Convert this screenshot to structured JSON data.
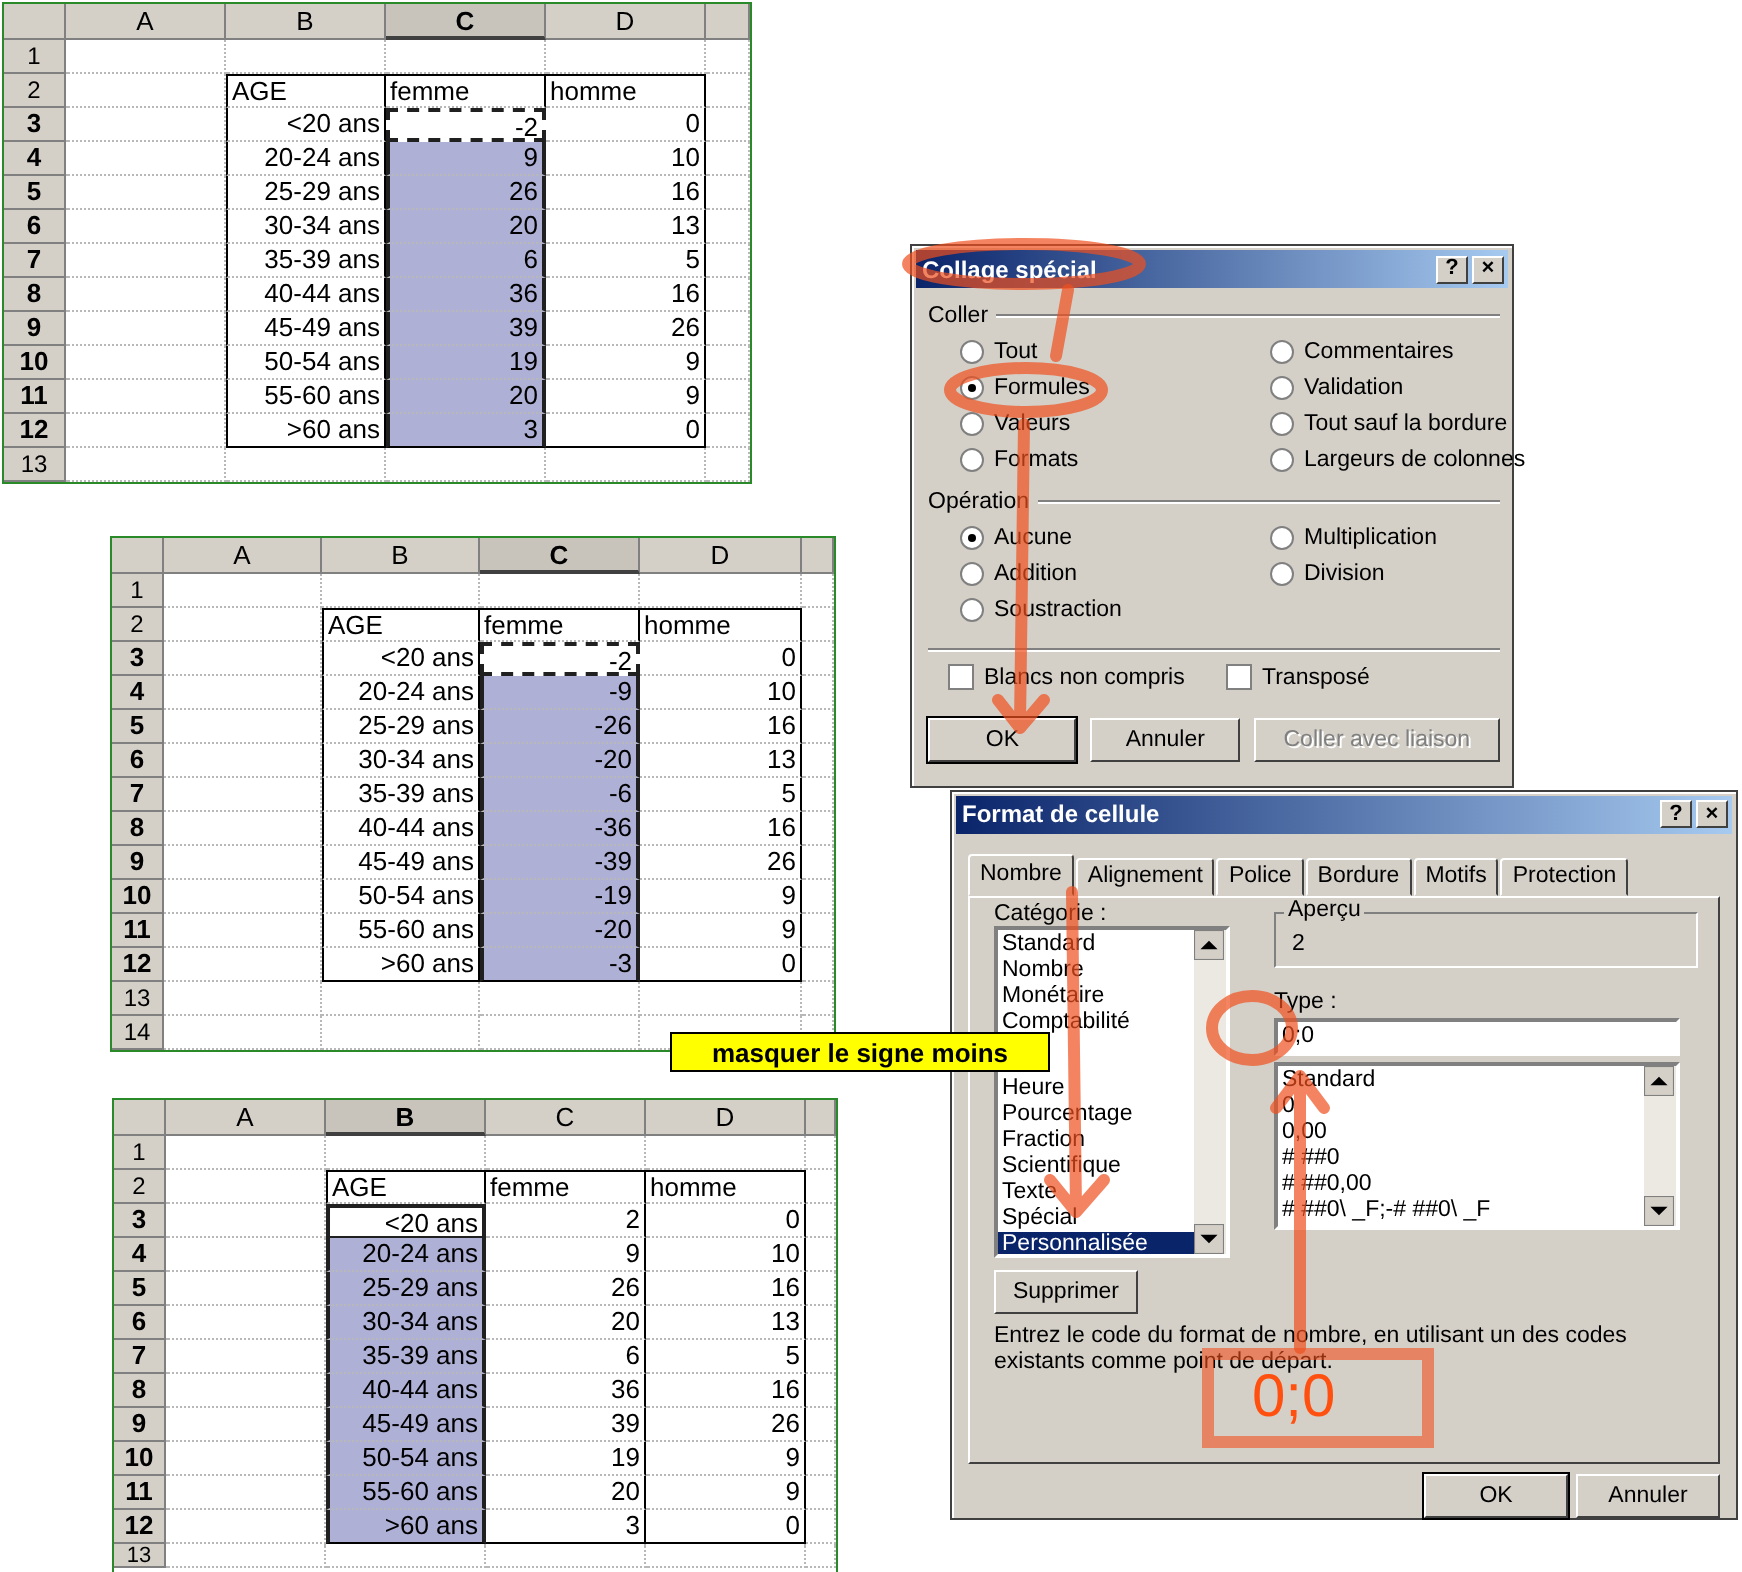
{
  "sheets": [
    {
      "columns": [
        {
          "label": "A",
          "selected": false
        },
        {
          "label": "B",
          "selected": false
        },
        {
          "label": "C",
          "selected": true
        },
        {
          "label": "D",
          "selected": false
        }
      ],
      "rows": [
        {
          "label": "1",
          "selected": false
        },
        {
          "label": "2",
          "selected": false,
          "cells": [
            {
              "text": "AGE",
              "selected": false
            },
            {
              "text": "femme",
              "selected": false
            },
            {
              "text": "homme",
              "selected": false
            }
          ]
        },
        {
          "label": "3",
          "selected": true,
          "cells": [
            {
              "text": "<20 ans",
              "selected": false
            },
            {
              "text": "-2",
              "selected": false,
              "marquee": true
            },
            {
              "text": "0",
              "selected": false
            }
          ]
        },
        {
          "label": "4",
          "selected": true,
          "cells": [
            {
              "text": "20-24 ans",
              "selected": false
            },
            {
              "text": "9",
              "selected": true
            },
            {
              "text": "10",
              "selected": false
            }
          ]
        },
        {
          "label": "5",
          "selected": true,
          "cells": [
            {
              "text": "25-29 ans",
              "selected": false
            },
            {
              "text": "26",
              "selected": true
            },
            {
              "text": "16",
              "selected": false
            }
          ]
        },
        {
          "label": "6",
          "selected": true,
          "cells": [
            {
              "text": "30-34 ans",
              "selected": false
            },
            {
              "text": "20",
              "selected": true
            },
            {
              "text": "13",
              "selected": false
            }
          ]
        },
        {
          "label": "7",
          "selected": true,
          "cells": [
            {
              "text": "35-39 ans",
              "selected": false
            },
            {
              "text": "6",
              "selected": true
            },
            {
              "text": "5",
              "selected": false
            }
          ]
        },
        {
          "label": "8",
          "selected": true,
          "cells": [
            {
              "text": "40-44 ans",
              "selected": false
            },
            {
              "text": "36",
              "selected": true
            },
            {
              "text": "16",
              "selected": false
            }
          ]
        },
        {
          "label": "9",
          "selected": true,
          "cells": [
            {
              "text": "45-49 ans",
              "selected": false
            },
            {
              "text": "39",
              "selected": true
            },
            {
              "text": "26",
              "selected": false
            }
          ]
        },
        {
          "label": "10",
          "selected": true,
          "cells": [
            {
              "text": "50-54 ans",
              "selected": false
            },
            {
              "text": "19",
              "selected": true
            },
            {
              "text": "9",
              "selected": false
            }
          ]
        },
        {
          "label": "11",
          "selected": true,
          "cells": [
            {
              "text": "55-60 ans",
              "selected": false
            },
            {
              "text": "20",
              "selected": true
            },
            {
              "text": "9",
              "selected": false
            }
          ]
        },
        {
          "label": "12",
          "selected": true,
          "cells": [
            {
              "text": ">60 ans",
              "selected": false
            },
            {
              "text": "3",
              "selected": true
            },
            {
              "text": "0",
              "selected": false
            }
          ]
        },
        {
          "label": "13",
          "selected": false
        }
      ]
    },
    {
      "columns": [
        {
          "label": "A",
          "selected": false
        },
        {
          "label": "B",
          "selected": false
        },
        {
          "label": "C",
          "selected": true
        },
        {
          "label": "D",
          "selected": false
        }
      ],
      "rows": [
        {
          "label": "1",
          "selected": false
        },
        {
          "label": "2",
          "selected": false,
          "cells": [
            {
              "text": "AGE",
              "selected": false
            },
            {
              "text": "femme",
              "selected": false
            },
            {
              "text": "homme",
              "selected": false
            }
          ]
        },
        {
          "label": "3",
          "selected": true,
          "cells": [
            {
              "text": "<20 ans",
              "selected": false
            },
            {
              "text": "-2",
              "selected": false,
              "marquee": true
            },
            {
              "text": "0",
              "selected": false
            }
          ]
        },
        {
          "label": "4",
          "selected": true,
          "cells": [
            {
              "text": "20-24 ans",
              "selected": false
            },
            {
              "text": "-9",
              "selected": true
            },
            {
              "text": "10",
              "selected": false
            }
          ]
        },
        {
          "label": "5",
          "selected": true,
          "cells": [
            {
              "text": "25-29 ans",
              "selected": false
            },
            {
              "text": "-26",
              "selected": true
            },
            {
              "text": "16",
              "selected": false
            }
          ]
        },
        {
          "label": "6",
          "selected": true,
          "cells": [
            {
              "text": "30-34 ans",
              "selected": false
            },
            {
              "text": "-20",
              "selected": true
            },
            {
              "text": "13",
              "selected": false
            }
          ]
        },
        {
          "label": "7",
          "selected": true,
          "cells": [
            {
              "text": "35-39 ans",
              "selected": false
            },
            {
              "text": "-6",
              "selected": true
            },
            {
              "text": "5",
              "selected": false
            }
          ]
        },
        {
          "label": "8",
          "selected": true,
          "cells": [
            {
              "text": "40-44 ans",
              "selected": false
            },
            {
              "text": "-36",
              "selected": true
            },
            {
              "text": "16",
              "selected": false
            }
          ]
        },
        {
          "label": "9",
          "selected": true,
          "cells": [
            {
              "text": "45-49 ans",
              "selected": false
            },
            {
              "text": "-39",
              "selected": true
            },
            {
              "text": "26",
              "selected": false
            }
          ]
        },
        {
          "label": "10",
          "selected": true,
          "cells": [
            {
              "text": "50-54 ans",
              "selected": false
            },
            {
              "text": "-19",
              "selected": true
            },
            {
              "text": "9",
              "selected": false
            }
          ]
        },
        {
          "label": "11",
          "selected": true,
          "cells": [
            {
              "text": "55-60 ans",
              "selected": false
            },
            {
              "text": "-20",
              "selected": true
            },
            {
              "text": "9",
              "selected": false
            }
          ]
        },
        {
          "label": "12",
          "selected": true,
          "cells": [
            {
              "text": ">60 ans",
              "selected": false
            },
            {
              "text": "-3",
              "selected": true
            },
            {
              "text": "0",
              "selected": false
            }
          ]
        },
        {
          "label": "13",
          "selected": false
        },
        {
          "label": "14",
          "selected": false
        }
      ]
    },
    {
      "columns": [
        {
          "label": "A",
          "selected": false
        },
        {
          "label": "B",
          "selected": true
        },
        {
          "label": "C",
          "selected": false
        },
        {
          "label": "D",
          "selected": false
        }
      ],
      "rows": [
        {
          "label": "1",
          "selected": false
        },
        {
          "label": "2",
          "selected": false,
          "cells": [
            {
              "text": "AGE",
              "selected": false
            },
            {
              "text": "femme",
              "selected": false
            },
            {
              "text": "homme",
              "selected": false
            }
          ]
        },
        {
          "label": "3",
          "selected": true,
          "cells": [
            {
              "text": "<20 ans",
              "selected": false,
              "active": true
            },
            {
              "text": "2",
              "selected": false
            },
            {
              "text": "0",
              "selected": false
            }
          ]
        },
        {
          "label": "4",
          "selected": true,
          "cells": [
            {
              "text": "20-24 ans",
              "selected": true
            },
            {
              "text": "9",
              "selected": false
            },
            {
              "text": "10",
              "selected": false
            }
          ]
        },
        {
          "label": "5",
          "selected": true,
          "cells": [
            {
              "text": "25-29 ans",
              "selected": true
            },
            {
              "text": "26",
              "selected": false
            },
            {
              "text": "16",
              "selected": false
            }
          ]
        },
        {
          "label": "6",
          "selected": true,
          "cells": [
            {
              "text": "30-34 ans",
              "selected": true
            },
            {
              "text": "20",
              "selected": false
            },
            {
              "text": "13",
              "selected": false
            }
          ]
        },
        {
          "label": "7",
          "selected": true,
          "cells": [
            {
              "text": "35-39 ans",
              "selected": true
            },
            {
              "text": "6",
              "selected": false
            },
            {
              "text": "5",
              "selected": false
            }
          ]
        },
        {
          "label": "8",
          "selected": true,
          "cells": [
            {
              "text": "40-44 ans",
              "selected": true
            },
            {
              "text": "36",
              "selected": false
            },
            {
              "text": "16",
              "selected": false
            }
          ]
        },
        {
          "label": "9",
          "selected": true,
          "cells": [
            {
              "text": "45-49 ans",
              "selected": true
            },
            {
              "text": "39",
              "selected": false
            },
            {
              "text": "26",
              "selected": false
            }
          ]
        },
        {
          "label": "10",
          "selected": true,
          "cells": [
            {
              "text": "50-54 ans",
              "selected": true
            },
            {
              "text": "19",
              "selected": false
            },
            {
              "text": "9",
              "selected": false
            }
          ]
        },
        {
          "label": "11",
          "selected": true,
          "cells": [
            {
              "text": "55-60 ans",
              "selected": true
            },
            {
              "text": "20",
              "selected": false
            },
            {
              "text": "9",
              "selected": false
            }
          ]
        },
        {
          "label": "12",
          "selected": true,
          "cells": [
            {
              "text": ">60 ans",
              "selected": true
            },
            {
              "text": "3",
              "selected": false
            },
            {
              "text": "0",
              "selected": false
            }
          ]
        },
        {
          "label": "13",
          "selected": false
        }
      ]
    }
  ],
  "paste_special": {
    "title": "Collage spécial",
    "title_buttons": [
      "?",
      "×"
    ],
    "groups": [
      {
        "label": "Coller",
        "options": [
          {
            "label": "Tout",
            "selected": false
          },
          {
            "label": "Formules",
            "selected": true
          },
          {
            "label": "Valeurs",
            "selected": false
          },
          {
            "label": "Formats",
            "selected": false
          },
          {
            "label": "Commentaires",
            "selected": false
          },
          {
            "label": "Validation",
            "selected": false
          },
          {
            "label": "Tout sauf la bordure",
            "selected": false
          },
          {
            "label": "Largeurs de colonnes",
            "selected": false
          }
        ]
      },
      {
        "label": "Opération",
        "options": [
          {
            "label": "Aucune",
            "selected": true
          },
          {
            "label": "Addition",
            "selected": false
          },
          {
            "label": "Soustraction",
            "selected": false
          },
          {
            "label": "Multiplication",
            "selected": false
          },
          {
            "label": "Division",
            "selected": false
          }
        ]
      }
    ],
    "checkboxes": [
      {
        "label": "Blancs non compris",
        "checked": false
      },
      {
        "label": "Transposé",
        "checked": false
      }
    ],
    "buttons": [
      {
        "label": "OK",
        "default": true,
        "disabled": false
      },
      {
        "label": "Annuler",
        "default": false,
        "disabled": false
      },
      {
        "label": "Coller avec liaison",
        "default": false,
        "disabled": true
      }
    ]
  },
  "format_cells": {
    "title": "Format de cellule",
    "title_buttons": [
      "?",
      "×"
    ],
    "tabs": [
      {
        "label": "Nombre",
        "selected": true
      },
      {
        "label": "Alignement",
        "selected": false
      },
      {
        "label": "Police",
        "selected": false
      },
      {
        "label": "Bordure",
        "selected": false
      },
      {
        "label": "Motifs",
        "selected": false
      },
      {
        "label": "Protection",
        "selected": false
      }
    ],
    "category": {
      "label": "Catégorie :",
      "items": [
        {
          "kind": "item",
          "label": "Standard",
          "selected": false
        },
        {
          "kind": "item",
          "label": "Nombre",
          "selected": false
        },
        {
          "kind": "item",
          "label": "Monétaire",
          "selected": false
        },
        {
          "kind": "item",
          "label": "Comptabilité",
          "selected": false
        },
        {
          "kind": "covered",
          "selected": false
        },
        {
          "kind": "item",
          "label": "Heure",
          "selected": false
        },
        {
          "kind": "item",
          "label": "Pourcentage",
          "selected": false
        },
        {
          "kind": "item",
          "label": "Fraction",
          "selected": false
        },
        {
          "kind": "item",
          "label": "Scientifique",
          "selected": false
        },
        {
          "kind": "item",
          "label": "Texte",
          "selected": false
        },
        {
          "kind": "item",
          "label": "Spécial",
          "selected": false
        },
        {
          "kind": "item",
          "label": "Personnalisée",
          "selected": true
        }
      ]
    },
    "preview": {
      "label": "Aperçu",
      "value": "2"
    },
    "type": {
      "label": "Type :",
      "value": "0;0",
      "options": [
        "Standard",
        "0",
        "0,00",
        "# ##0",
        "# ##0,00",
        "# ##0\\ _F;-# ##0\\ _F"
      ]
    },
    "delete_button": "Supprimer",
    "hint": "Entrez le code du format de nombre, en utilisant un des codes existants comme point de départ.",
    "buttons": [
      {
        "label": "OK",
        "default": true
      },
      {
        "label": "Annuler",
        "default": false
      }
    ]
  },
  "callout": "masquer le signe moins",
  "annotation": {
    "text": "0;0"
  }
}
